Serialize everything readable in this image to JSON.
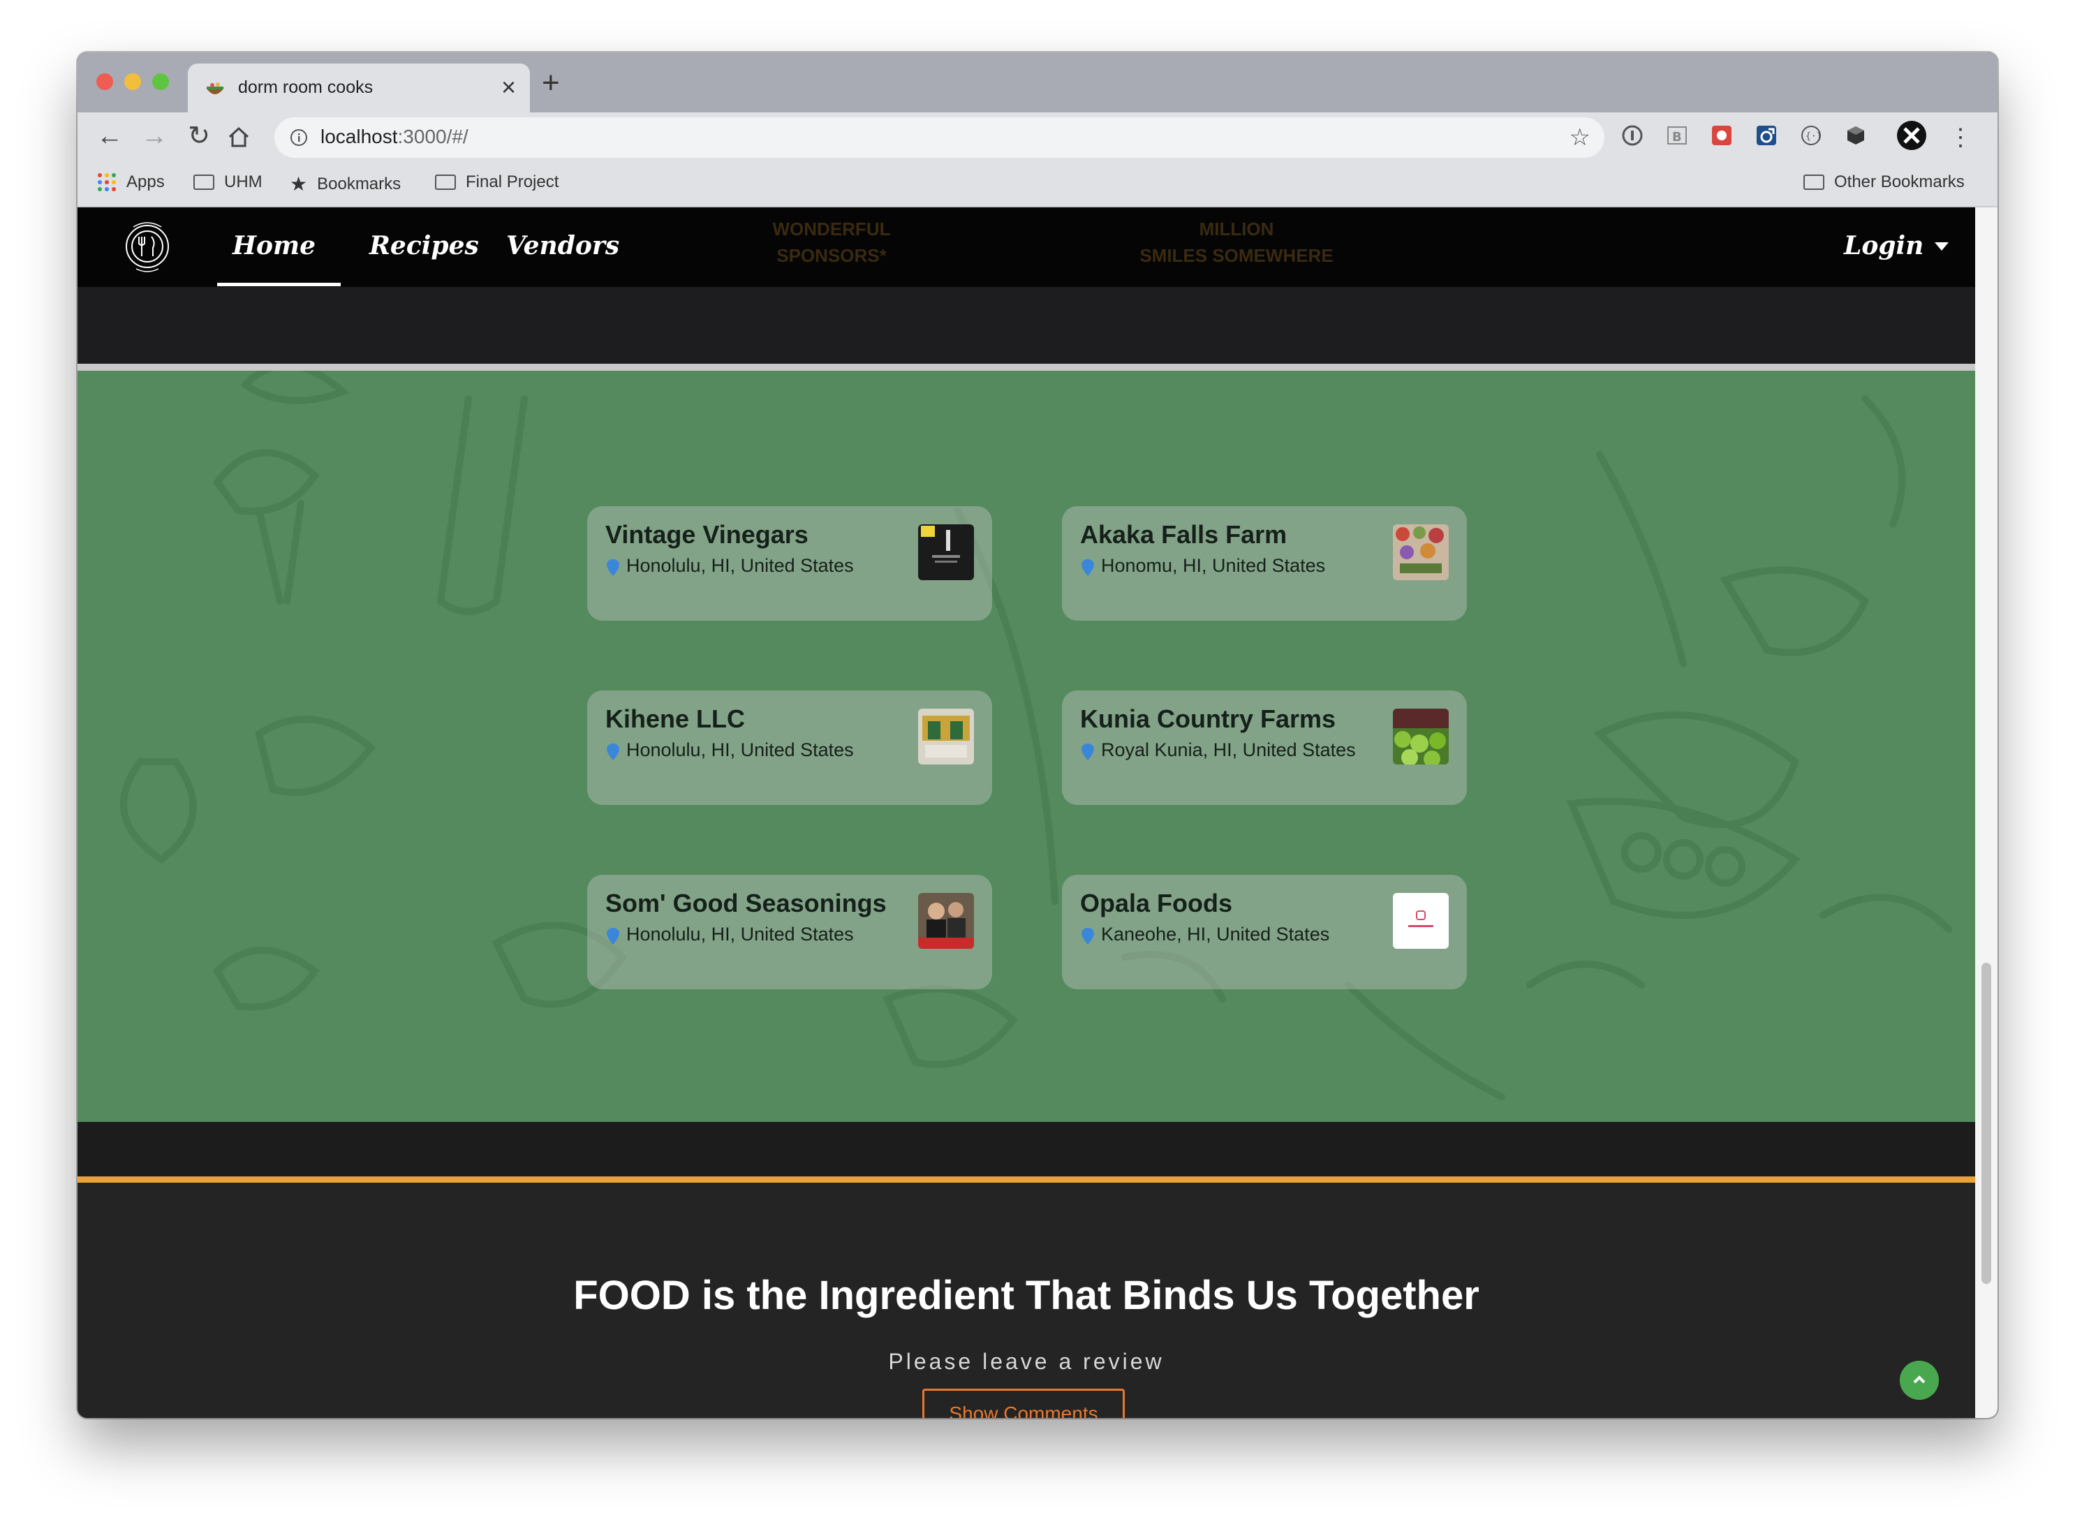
{
  "browser": {
    "tab_title": "dorm room cooks",
    "tab_close": "×",
    "new_tab": "+",
    "url_host": "localhost",
    "url_rest": ":3000/#/",
    "bookmarks": {
      "apps": "Apps",
      "uhm": "UHM",
      "bookmarks": "Bookmarks",
      "final_project": "Final Project",
      "other": "Other Bookmarks"
    }
  },
  "navbar": {
    "home": "Home",
    "recipes": "Recipes",
    "vendors": "Vendors",
    "login": "Login",
    "ghost_stat_1_line1": "WONDERFUL",
    "ghost_stat_1_line2": "SPONSORS*",
    "ghost_stat_2_line1": "MILLION",
    "ghost_stat_2_line2": "SMILES SOMEWHERE"
  },
  "vendors": [
    {
      "name": "Vintage Vinegars",
      "location": "Honolulu, HI, United States"
    },
    {
      "name": "Akaka Falls Farm",
      "location": "Honomu, HI, United States"
    },
    {
      "name": "Kihene LLC",
      "location": "Honolulu, HI, United States"
    },
    {
      "name": "Kunia Country Farms",
      "location": "Royal Kunia, HI, United States"
    },
    {
      "name": "Som' Good Seasonings",
      "location": "Honolulu, HI, United States"
    },
    {
      "name": "Opala Foods",
      "location": "Kaneohe, HI, United States"
    }
  ],
  "footer": {
    "title": "FOOD is the Ingredient That Binds Us Together",
    "subtitle": "Please leave a review",
    "button": "Show Comments"
  },
  "colors": {
    "green_section": "#548a5d",
    "accent_orange": "#e8782e",
    "divider_gold": "#e8a33a",
    "to_top_green": "#49a84f"
  }
}
